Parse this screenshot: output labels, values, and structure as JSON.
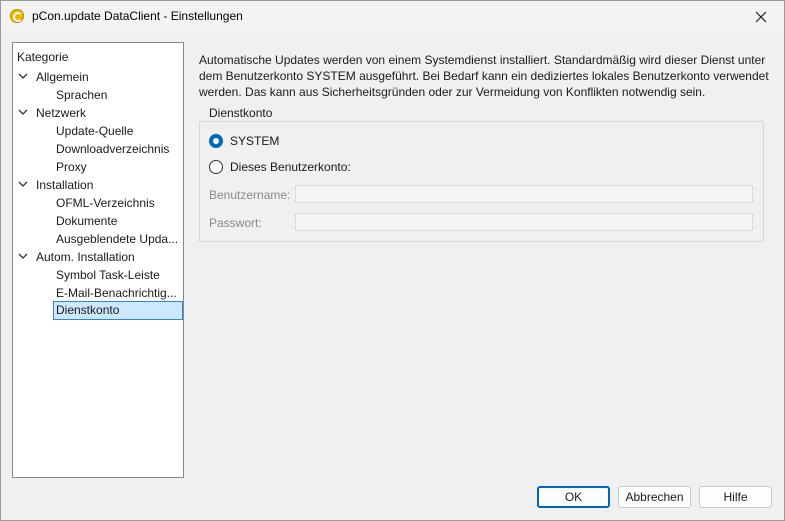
{
  "window": {
    "title": "pCon.update DataClient - Einstellungen"
  },
  "sidebar": {
    "heading": "Kategorie",
    "groups": [
      {
        "label": "Allgemein",
        "children": [
          "Sprachen"
        ]
      },
      {
        "label": "Netzwerk",
        "children": [
          "Update-Quelle",
          "Downloadverzeichnis",
          "Proxy"
        ]
      },
      {
        "label": "Installation",
        "children": [
          "OFML-Verzeichnis",
          "Dokumente",
          "Ausgeblendete Upda..."
        ]
      },
      {
        "label": "Autom. Installation",
        "children": [
          "Symbol Task-Leiste",
          "E-Mail-Benachrichtig...",
          "Dienstkonto"
        ]
      }
    ],
    "selected": "Dienstkonto"
  },
  "main": {
    "description_lines": [
      "Automatische Updates werden von einem Systemdienst installiert. Standardmäßig wird dieser Dienst unter",
      "dem Benutzerkonto SYSTEM ausgeführt. Bei Bedarf kann ein dediziertes lokales Benutzerkonto verwendet",
      "werden. Das kann aus Sicherheitsgründen oder zur Vermeidung von Konflikten notwendig sein."
    ],
    "group_title": "Dienstkonto",
    "radio_system": {
      "label": "SYSTEM",
      "checked": true
    },
    "radio_user": {
      "label": "Dieses Benutzerkonto:",
      "checked": false
    },
    "username_label": "Benutzername:",
    "username_value": "",
    "password_label": "Passwort:",
    "password_value": ""
  },
  "buttons": {
    "ok": "OK",
    "cancel": "Abbrechen",
    "help": "Hilfe"
  },
  "colors": {
    "accent": "#0067c0",
    "selection_bg": "#cce8ff",
    "selection_border": "#2f86d4"
  }
}
